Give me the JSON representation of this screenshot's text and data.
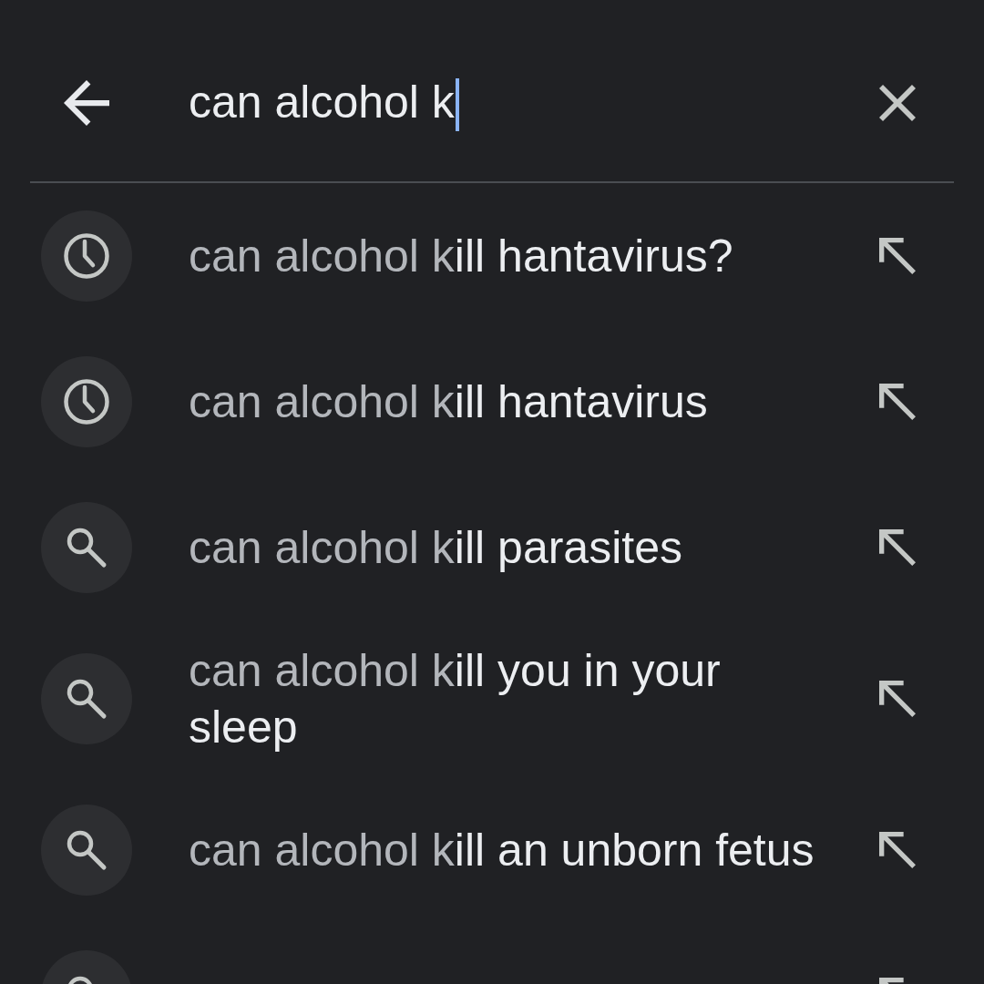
{
  "search": {
    "value": "can alcohol k",
    "focused": true
  },
  "suggestions": [
    {
      "kind": "history",
      "prefix": "can alcohol k",
      "completion": "ill hantavirus?"
    },
    {
      "kind": "history",
      "prefix": "can alcohol k",
      "completion": "ill hantavirus"
    },
    {
      "kind": "search",
      "prefix": "can alcohol k",
      "completion": "ill parasites"
    },
    {
      "kind": "search",
      "prefix": "can alcohol k",
      "completion": "ill you in your sleep"
    },
    {
      "kind": "search",
      "prefix": "can alcohol k",
      "completion": "ill an unborn fetus"
    },
    {
      "kind": "search"
    }
  ]
}
